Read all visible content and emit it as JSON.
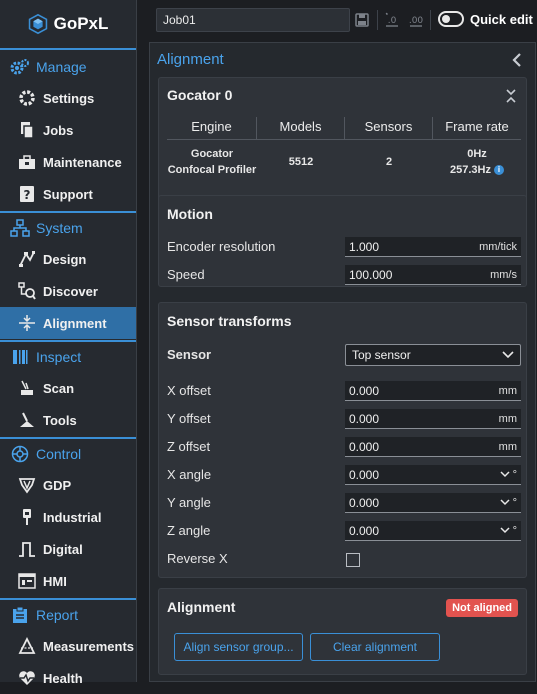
{
  "app": {
    "name": "GoPxL"
  },
  "sidebar": {
    "sections": [
      {
        "label": "Manage",
        "items": [
          "Settings",
          "Jobs",
          "Maintenance",
          "Support"
        ]
      },
      {
        "label": "System",
        "items": [
          "Design",
          "Discover",
          "Alignment"
        ]
      },
      {
        "label": "Inspect",
        "items": [
          "Scan",
          "Tools"
        ]
      },
      {
        "label": "Control",
        "items": [
          "GDP",
          "Industrial",
          "Digital",
          "HMI"
        ]
      },
      {
        "label": "Report",
        "items": [
          "Measurements",
          "Health"
        ]
      }
    ],
    "active_item": "Alignment"
  },
  "toolbar": {
    "job_name": "Job01",
    "quick_edit_label": "Quick edit",
    "quick_edit_on": false
  },
  "main": {
    "title": "Alignment",
    "sensor_card": {
      "title": "Gocator 0",
      "columns": [
        "Engine",
        "Models",
        "Sensors",
        "Frame rate"
      ],
      "row": {
        "engine": "Gocator\nConfocal Profiler",
        "models": "5512",
        "sensors": "2",
        "frame_rate_1": "0Hz",
        "frame_rate_2": "257.3Hz"
      }
    },
    "motion": {
      "title": "Motion",
      "fields": [
        {
          "label": "Encoder resolution",
          "value": "1.000",
          "unit": "mm/tick"
        },
        {
          "label": "Speed",
          "value": "100.000",
          "unit": "mm/s"
        }
      ]
    },
    "transforms": {
      "title": "Sensor transforms",
      "sensor_label": "Sensor",
      "sensor_value": "Top sensor",
      "fields": [
        {
          "label": "X offset",
          "value": "0.000",
          "unit": "mm"
        },
        {
          "label": "Y offset",
          "value": "0.000",
          "unit": "mm"
        },
        {
          "label": "Z offset",
          "value": "0.000",
          "unit": "mm"
        },
        {
          "label": "X angle",
          "value": "0.000",
          "unit": "°"
        },
        {
          "label": "Y angle",
          "value": "0.000",
          "unit": "°"
        },
        {
          "label": "Z angle",
          "value": "0.000",
          "unit": "°"
        }
      ],
      "reverse_label": "Reverse X",
      "reverse_checked": false
    },
    "alignment": {
      "title": "Alignment",
      "status": "Not aligned",
      "status_color": "#e2534f",
      "align_button": "Align sensor group...",
      "clear_button": "Clear alignment"
    }
  },
  "colors": {
    "accent": "#3a8fd6",
    "active_nav": "#2f6fa6",
    "panel": "#2f3339"
  }
}
